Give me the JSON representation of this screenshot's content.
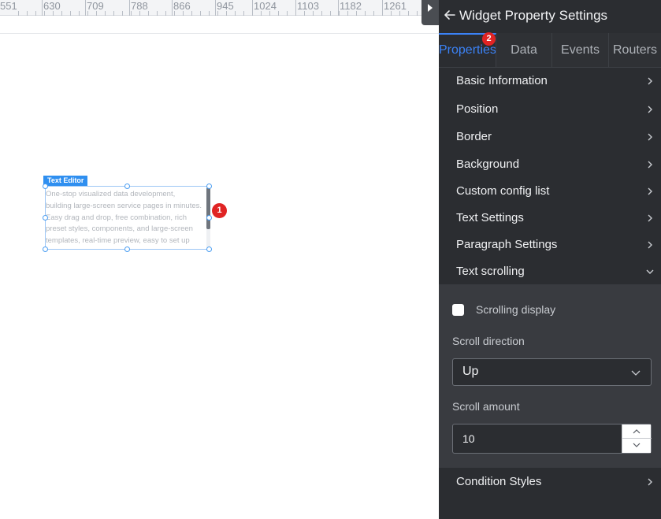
{
  "ruler": {
    "numbers": [
      "551",
      "630",
      "709",
      "788",
      "866",
      "945",
      "1024",
      "1103",
      "1182",
      "1261"
    ]
  },
  "widget": {
    "label": "Text Editor",
    "text_lines": [
      "One-stop visualized data development,",
      "building large-screen service pages in minutes.",
      "Easy drag and drop, free combination, rich",
      "preset styles, components, and large-screen",
      "templates, real-time preview, easy to set up"
    ],
    "scroll_position": 0.0
  },
  "badges": {
    "widget_badge": "1",
    "tab_badge": "2"
  },
  "panel": {
    "title": "Widget Property Settings",
    "tabs": [
      {
        "label": "Properties",
        "active": true
      },
      {
        "label": "Data",
        "active": false
      },
      {
        "label": "Events",
        "active": false
      },
      {
        "label": "Routers",
        "active": false
      }
    ],
    "sections": [
      {
        "label": "Basic Information",
        "expanded": false
      },
      {
        "label": "Position",
        "expanded": false
      },
      {
        "label": "Border",
        "expanded": false
      },
      {
        "label": "Background",
        "expanded": false
      },
      {
        "label": "Custom config list",
        "expanded": false
      },
      {
        "label": "Text Settings",
        "expanded": false
      },
      {
        "label": "Paragraph Settings",
        "expanded": false
      },
      {
        "label": "Text scrolling",
        "expanded": true
      },
      {
        "label": "Condition Styles",
        "expanded": false
      }
    ],
    "text_scrolling": {
      "checkbox_label": "Scrolling display",
      "checked": false,
      "direction_label": "Scroll direction",
      "direction_value": "Up",
      "amount_label": "Scroll amount",
      "amount_value": "10"
    }
  },
  "colors": {
    "accent": "#3b82f6",
    "panel_bg": "#2b2d31",
    "badge": "#e02424",
    "widget_label_bg": "#2f8ff0"
  },
  "icons": {
    "back": "arrow-left-icon",
    "section_closed": "chevron-right-icon",
    "section_open": "chevron-down-icon",
    "collapse_toggle": "caret-right-icon",
    "select": "chevron-down-icon",
    "step_up": "chevron-up-icon",
    "step_down": "chevron-down-icon"
  }
}
